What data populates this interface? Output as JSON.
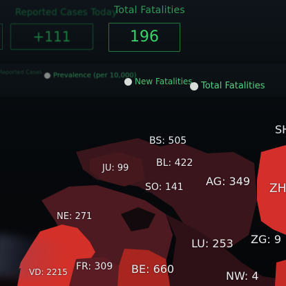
{
  "stats": {
    "reported_cases_today": {
      "label": "Reported Cases Today",
      "value": "+111"
    },
    "total_fatalities": {
      "label": "Total Fatalities",
      "value": "196"
    }
  },
  "legend": {
    "items": [
      {
        "label": "Reported Cases"
      },
      {
        "label": "Prevalence (per 10,000)"
      },
      {
        "label": "New Fatalities"
      },
      {
        "label": "Total Fatalities"
      }
    ]
  },
  "map": {
    "cantons": [
      {
        "label": "BS: 505"
      },
      {
        "label": "BL: 422"
      },
      {
        "label": "JU: 99"
      },
      {
        "label": "SO: 141"
      },
      {
        "label": "AG: 349"
      },
      {
        "label": "ZH"
      },
      {
        "label": "SH"
      },
      {
        "label": "NE: 271"
      },
      {
        "label": "LU: 253"
      },
      {
        "label": "ZG: 9"
      },
      {
        "label": "VD: 2215"
      },
      {
        "label": "FR: 309"
      },
      {
        "label": "BE: 660"
      },
      {
        "label": "NW: 4"
      }
    ]
  },
  "colors": {
    "accent_green": "#2fbf5e",
    "map_dark_red": "#5a1d24",
    "map_bright_red": "#d9302b",
    "map_darkest": "#3a141a"
  }
}
